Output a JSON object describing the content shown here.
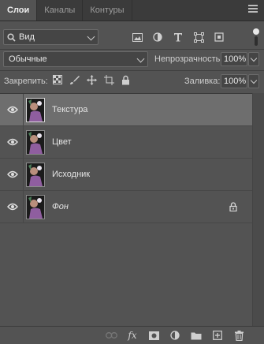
{
  "tabs": [
    {
      "label": "Слои",
      "active": true
    },
    {
      "label": "Каналы",
      "active": false
    },
    {
      "label": "Контуры",
      "active": false
    }
  ],
  "filter": {
    "kind_label": "Вид",
    "icons": [
      "image-filter-icon",
      "adjustment-filter-icon",
      "type-filter-icon",
      "shape-filter-icon",
      "smart-object-filter-icon"
    ]
  },
  "blend": {
    "mode": "Обычные",
    "opacity_label": "Непрозрачность:",
    "opacity_value": "100%"
  },
  "lock": {
    "label": "Закрепить:",
    "icons": [
      "lock-transparent-pixels-icon",
      "lock-image-pixels-icon",
      "lock-position-icon",
      "lock-artboard-icon",
      "lock-all-icon"
    ],
    "fill_label": "Заливка:",
    "fill_value": "100%"
  },
  "layers": [
    {
      "name": "Текстура",
      "selected": true,
      "italic": false,
      "locked": false,
      "visible": true
    },
    {
      "name": "Цвет",
      "selected": false,
      "italic": false,
      "locked": false,
      "visible": true
    },
    {
      "name": "Исходник",
      "selected": false,
      "italic": false,
      "locked": false,
      "visible": true
    },
    {
      "name": "Фон",
      "selected": false,
      "italic": true,
      "locked": true,
      "visible": true
    }
  ],
  "bottom_bar": {
    "fx_label": "fx",
    "icons": [
      "link-layers-icon",
      "add-style-icon",
      "add-mask-icon",
      "adjustment-layer-icon",
      "new-group-icon",
      "new-layer-icon",
      "delete-layer-icon"
    ]
  },
  "colors": {
    "panel_bg": "#535353",
    "tab_bar_bg": "#3b3b3b",
    "selected_layer": "#6e6e6e",
    "text": "#d6d6d6"
  }
}
